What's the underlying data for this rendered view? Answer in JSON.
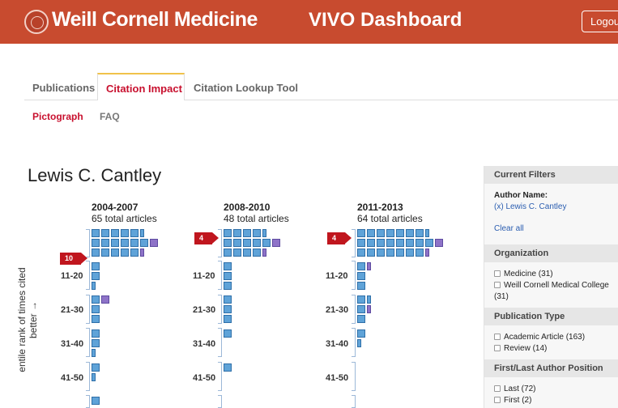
{
  "header": {
    "brand": "Weill Cornell Medicine",
    "title": "VIVO Dashboard",
    "logout_label": "Logout",
    "color": "#c84b2f"
  },
  "tabs": [
    {
      "label": "Publications",
      "active": false
    },
    {
      "label": "Citation Impact",
      "active": true
    },
    {
      "label": "Citation Lookup Tool",
      "active": false
    }
  ],
  "subtabs": [
    {
      "label": "Pictograph",
      "active": true
    },
    {
      "label": "FAQ",
      "active": false
    }
  ],
  "author_name": "Lewis C. Cantley",
  "pictograph": {
    "y_axis_label": "entile rank of times cited",
    "y_axis_sub": "better →",
    "columns": [
      {
        "period": "2004-2007",
        "total": "65 total articles",
        "top_badge": "10"
      },
      {
        "period": "2008-2010",
        "total": "48 total articles",
        "top_badge": "4"
      },
      {
        "period": "2011-2013",
        "total": "64 total articles",
        "top_badge": "4"
      }
    ],
    "row_labels": [
      "11-20",
      "21-30",
      "31-40",
      "41-50"
    ],
    "colors": {
      "blue": "#5fa3d8",
      "purple": "#8e73c8",
      "badge": "#c0161e"
    }
  },
  "sidebar": {
    "current_filters": "Current Filters",
    "author_name_label": "Author Name:",
    "author_filter": "(x) Lewis C. Cantley",
    "clear_all": "Clear all",
    "organization": "Organization",
    "org_items": [
      "Medicine (31)",
      "Weill Cornell Medical College",
      "(31)"
    ],
    "publication_type": "Publication Type",
    "pub_items": [
      "Academic Article (163)",
      "Review (14)"
    ],
    "author_position": "First/Last Author Position",
    "pos_items": [
      "Last (72)",
      "First (2)"
    ]
  }
}
